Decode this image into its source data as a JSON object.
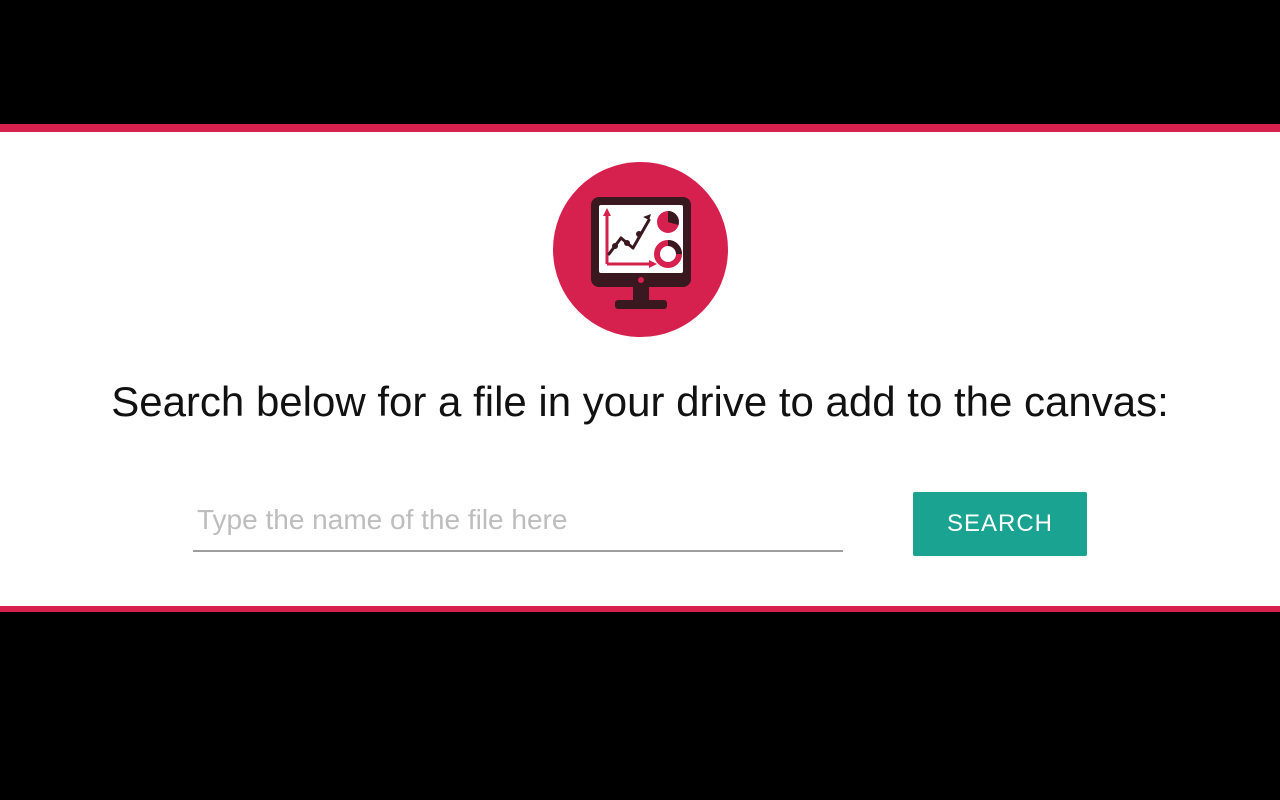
{
  "colors": {
    "accent": "#d6214e",
    "button_bg": "#1ba392",
    "button_fg": "#ffffff",
    "icon_dark": "#3a1820"
  },
  "icon": {
    "name": "monitor-analytics-icon"
  },
  "heading": "Search below for a file in your drive to add to the canvas:",
  "search": {
    "placeholder": "Type the name of the file here",
    "value": "",
    "button_label": "SEARCH"
  }
}
